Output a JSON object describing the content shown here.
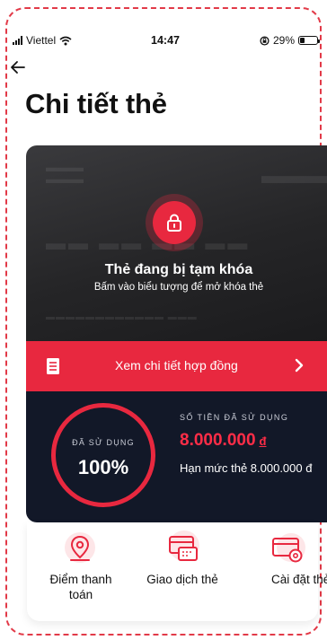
{
  "status_bar": {
    "carrier": "Viettel",
    "time": "14:47",
    "battery": "29%",
    "battery_level": 0.29
  },
  "header": {
    "title": "Chi tiết thẻ"
  },
  "card": {
    "lock_title": "Thẻ đang bị tạm khóa",
    "lock_subtitle": "Bấm vào biểu tượng để mở khóa thẻ"
  },
  "contract": {
    "label": "Xem chi tiết hợp đồng"
  },
  "usage": {
    "used_percent_label": "ĐÃ SỬ DỤNG",
    "used_percent": "100%",
    "used_amount_label": "SỐ TIỀN ĐÃ SỬ DỤNG",
    "used_amount": "8.000.000",
    "currency": "đ",
    "limit_text": "Hạn mức thẻ 8.000.000 đ"
  },
  "actions": [
    {
      "label": "Điểm thanh toán",
      "icon": "map-pin-icon"
    },
    {
      "label": "Giao dịch thẻ",
      "icon": "card-transactions-icon"
    },
    {
      "label": "Cài đặt thẻ",
      "icon": "card-settings-icon"
    }
  ],
  "colors": {
    "accent": "#e8283f",
    "dark_panel": "#121828",
    "card_bg": "#252527"
  }
}
